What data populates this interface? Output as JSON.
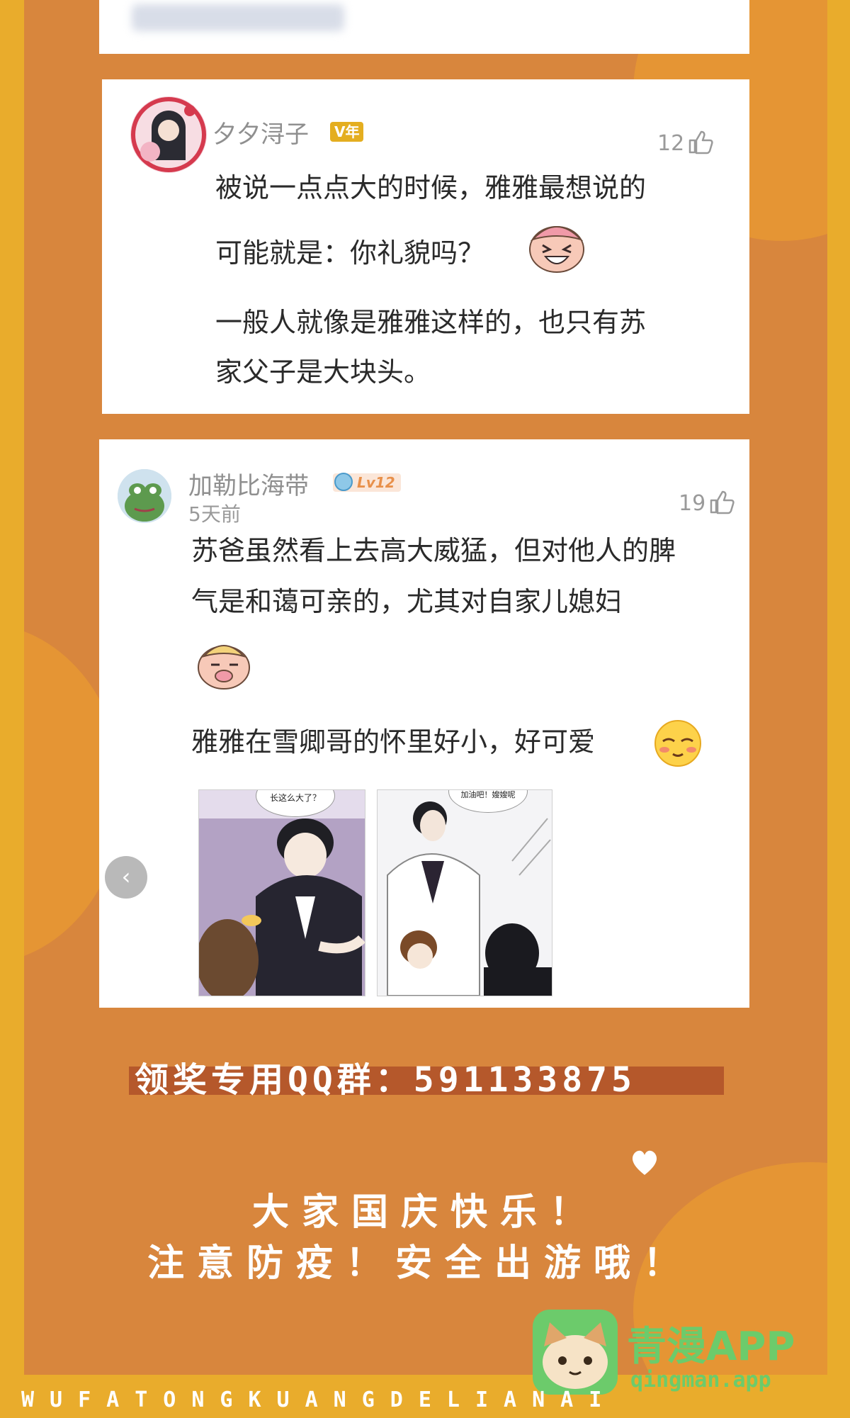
{
  "comments": [
    {
      "username": "夕夕浔子",
      "badge": "V年",
      "likes": "12",
      "text_lines": [
        "被说一点点大的时候，雅雅最想说的",
        "可能就是：你礼貌吗？",
        "一般人就像是雅雅这样的，也只有苏",
        "家父子是大块头。"
      ]
    },
    {
      "username": "加勒比海带",
      "level": "Lv12",
      "date": "5天前",
      "likes": "19",
      "text_lines": [
        "苏爸虽然看上去高大威猛，但对他人的脾",
        "气是和蔼可亲的，尤其对自家儿媳妇",
        "雅雅在雪卿哥的怀里好小，好可爱"
      ],
      "images": [
        {
          "bubble": "长这么大了？"
        },
        {
          "bubble": "加油吧！嫂嫂呢"
        }
      ],
      "carousel_prev": "‹"
    }
  ],
  "banner": {
    "qq_group": "领奖专用QQ群：591133875",
    "greeting_line1": "大家国庆快乐！",
    "greeting_line2": "注意防疫！安全出游哦！"
  },
  "footer": {
    "letters": "WUFATONGKUANGDELIANAI",
    "app_name": "青漫APP",
    "app_url": "qingman.app"
  },
  "colors": {
    "background": "#d8863d",
    "border": "#e9ac2c",
    "accent_green": "#6ccb6b"
  }
}
